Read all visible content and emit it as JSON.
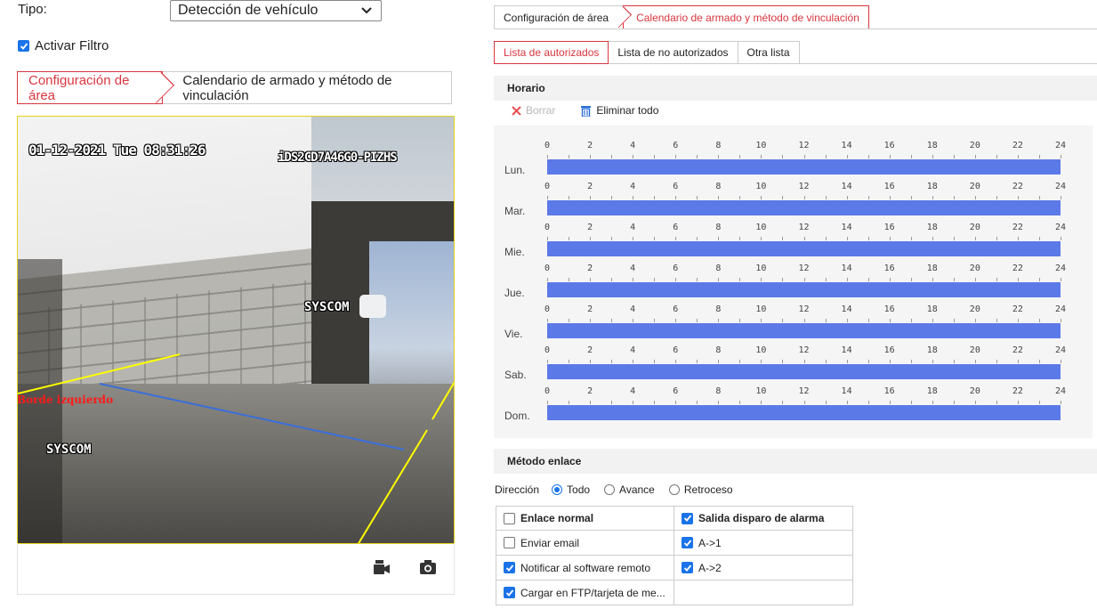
{
  "filter": {
    "type_label": "Tipo:",
    "type_value": "Detección de vehículo",
    "filter_checkbox_label": "Activar Filtro",
    "filter_checked": true
  },
  "left_tabs": {
    "area_config": "Configuración de área",
    "schedule_linkage": "Calendario de armado y método de vinculación"
  },
  "video": {
    "osd_datetime": "01-12-2021 Tue 08:31:26",
    "osd_model": "iDS2CD7A46G0-PIZHS",
    "watermark": "SYSCOM",
    "edge_label": "Borde izquierdo",
    "edge_line_color": "#ffff00",
    "direction_line_color": "#3a6fd9",
    "tools": [
      "record-icon",
      "camera-icon"
    ]
  },
  "right_tabs": {
    "area_config": "Configuración de área",
    "schedule_linkage": "Calendario de armado y método de vinculación"
  },
  "list_tabs": [
    "Lista de autorizados",
    "Lista de no autorizados",
    "Otra lista"
  ],
  "schedule": {
    "title": "Horario",
    "delete_label": "Borrar",
    "delete_all_label": "Eliminar todo",
    "hours": [
      "0",
      "2",
      "4",
      "6",
      "8",
      "10",
      "12",
      "14",
      "16",
      "18",
      "20",
      "22",
      "24"
    ],
    "days": [
      "Lun.",
      "Mar.",
      "Mie.",
      "Jue.",
      "Vie.",
      "Sab.",
      "Dom."
    ],
    "bar_color": "#5c79e8",
    "armed_range": [
      0,
      24
    ]
  },
  "linkage": {
    "title": "Método enlace",
    "direction_label": "Dirección",
    "directions": [
      {
        "label": "Todo",
        "selected": true
      },
      {
        "label": "Avance",
        "selected": false
      },
      {
        "label": "Retroceso",
        "selected": false
      }
    ],
    "normal_header": "Enlace normal",
    "normal_header_checked": false,
    "alarm_header": "Salida disparo de alarma",
    "alarm_header_checked": true,
    "normal_items": [
      {
        "label": "Enviar email",
        "checked": false
      },
      {
        "label": "Notificar al software remoto",
        "checked": true
      },
      {
        "label": "Cargar en FTP/tarjeta de me...",
        "checked": true
      }
    ],
    "alarm_items": [
      {
        "label": "A->1",
        "checked": true
      },
      {
        "label": "A->2",
        "checked": true
      }
    ]
  }
}
